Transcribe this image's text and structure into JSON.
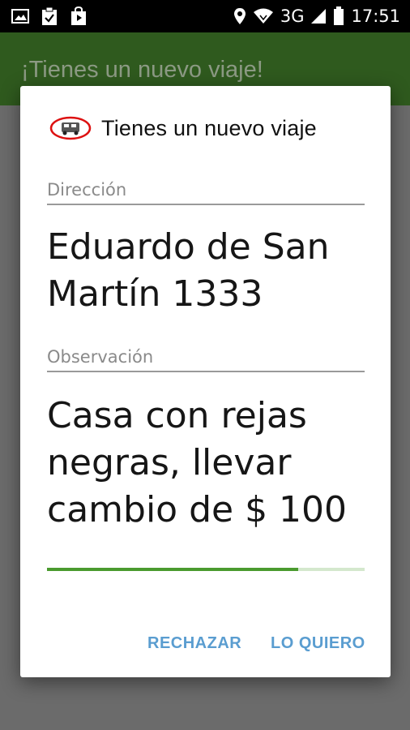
{
  "status_bar": {
    "icons_left": [
      "image-icon",
      "clipboard-check-icon",
      "shopping-bag-icon"
    ],
    "network": "3G",
    "time": "17:51"
  },
  "app_bar": {
    "title": "¡Tienes un nuevo viaje!"
  },
  "dialog": {
    "title": "Tienes un nuevo viaje",
    "address_label": "Dirección",
    "address_line1": "Eduardo de San",
    "address_line2": "Martín 1333",
    "note_label": "Observación",
    "note_line1": "Casa con rejas",
    "note_line2": "negras, llevar",
    "note_line3": "cambio de $ 100",
    "progress": 0.79,
    "reject_label": "RECHAZAR",
    "accept_label": "LO QUIERO"
  },
  "colors": {
    "app_bar": "#2f5a1e",
    "accent_button": "#5a9dd0",
    "progress": "#4a9a2e"
  }
}
